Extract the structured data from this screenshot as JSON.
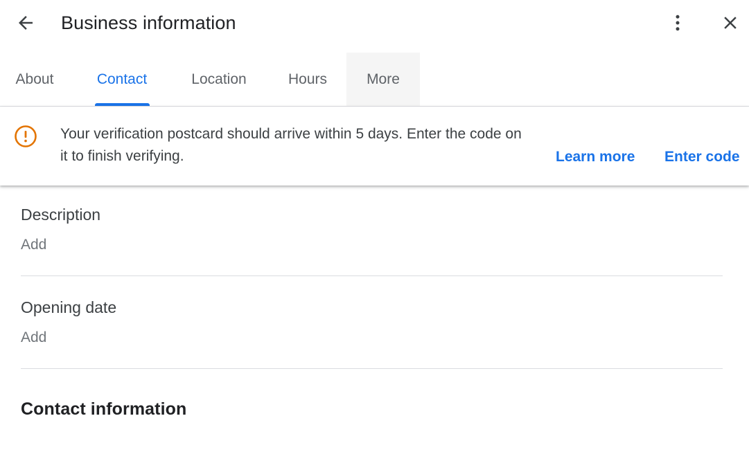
{
  "header": {
    "title": "Business information",
    "back_icon": "arrow-left-icon",
    "more_icon": "more-vertical-icon",
    "close_icon": "close-icon"
  },
  "tabs": [
    {
      "label": "About",
      "active": false
    },
    {
      "label": "Contact",
      "active": true
    },
    {
      "label": "Location",
      "active": false
    },
    {
      "label": "Hours",
      "active": false
    },
    {
      "label": "More",
      "active": false
    }
  ],
  "banner": {
    "icon": "alert-circle-icon",
    "message": "Your verification postcard should arrive within 5 days. Enter the code on it to finish verifying.",
    "learn_more": "Learn more",
    "enter_code": "Enter code",
    "icon_color": "#e37400"
  },
  "sections": {
    "description": {
      "label": "Description",
      "action": "Add"
    },
    "opening_date": {
      "label": "Opening date",
      "action": "Add"
    },
    "contact_information": {
      "label": "Contact information"
    }
  },
  "colors": {
    "accent": "#1a73e8",
    "text": "#202124",
    "secondary_text": "#5f6368",
    "divider": "#dadce0"
  }
}
